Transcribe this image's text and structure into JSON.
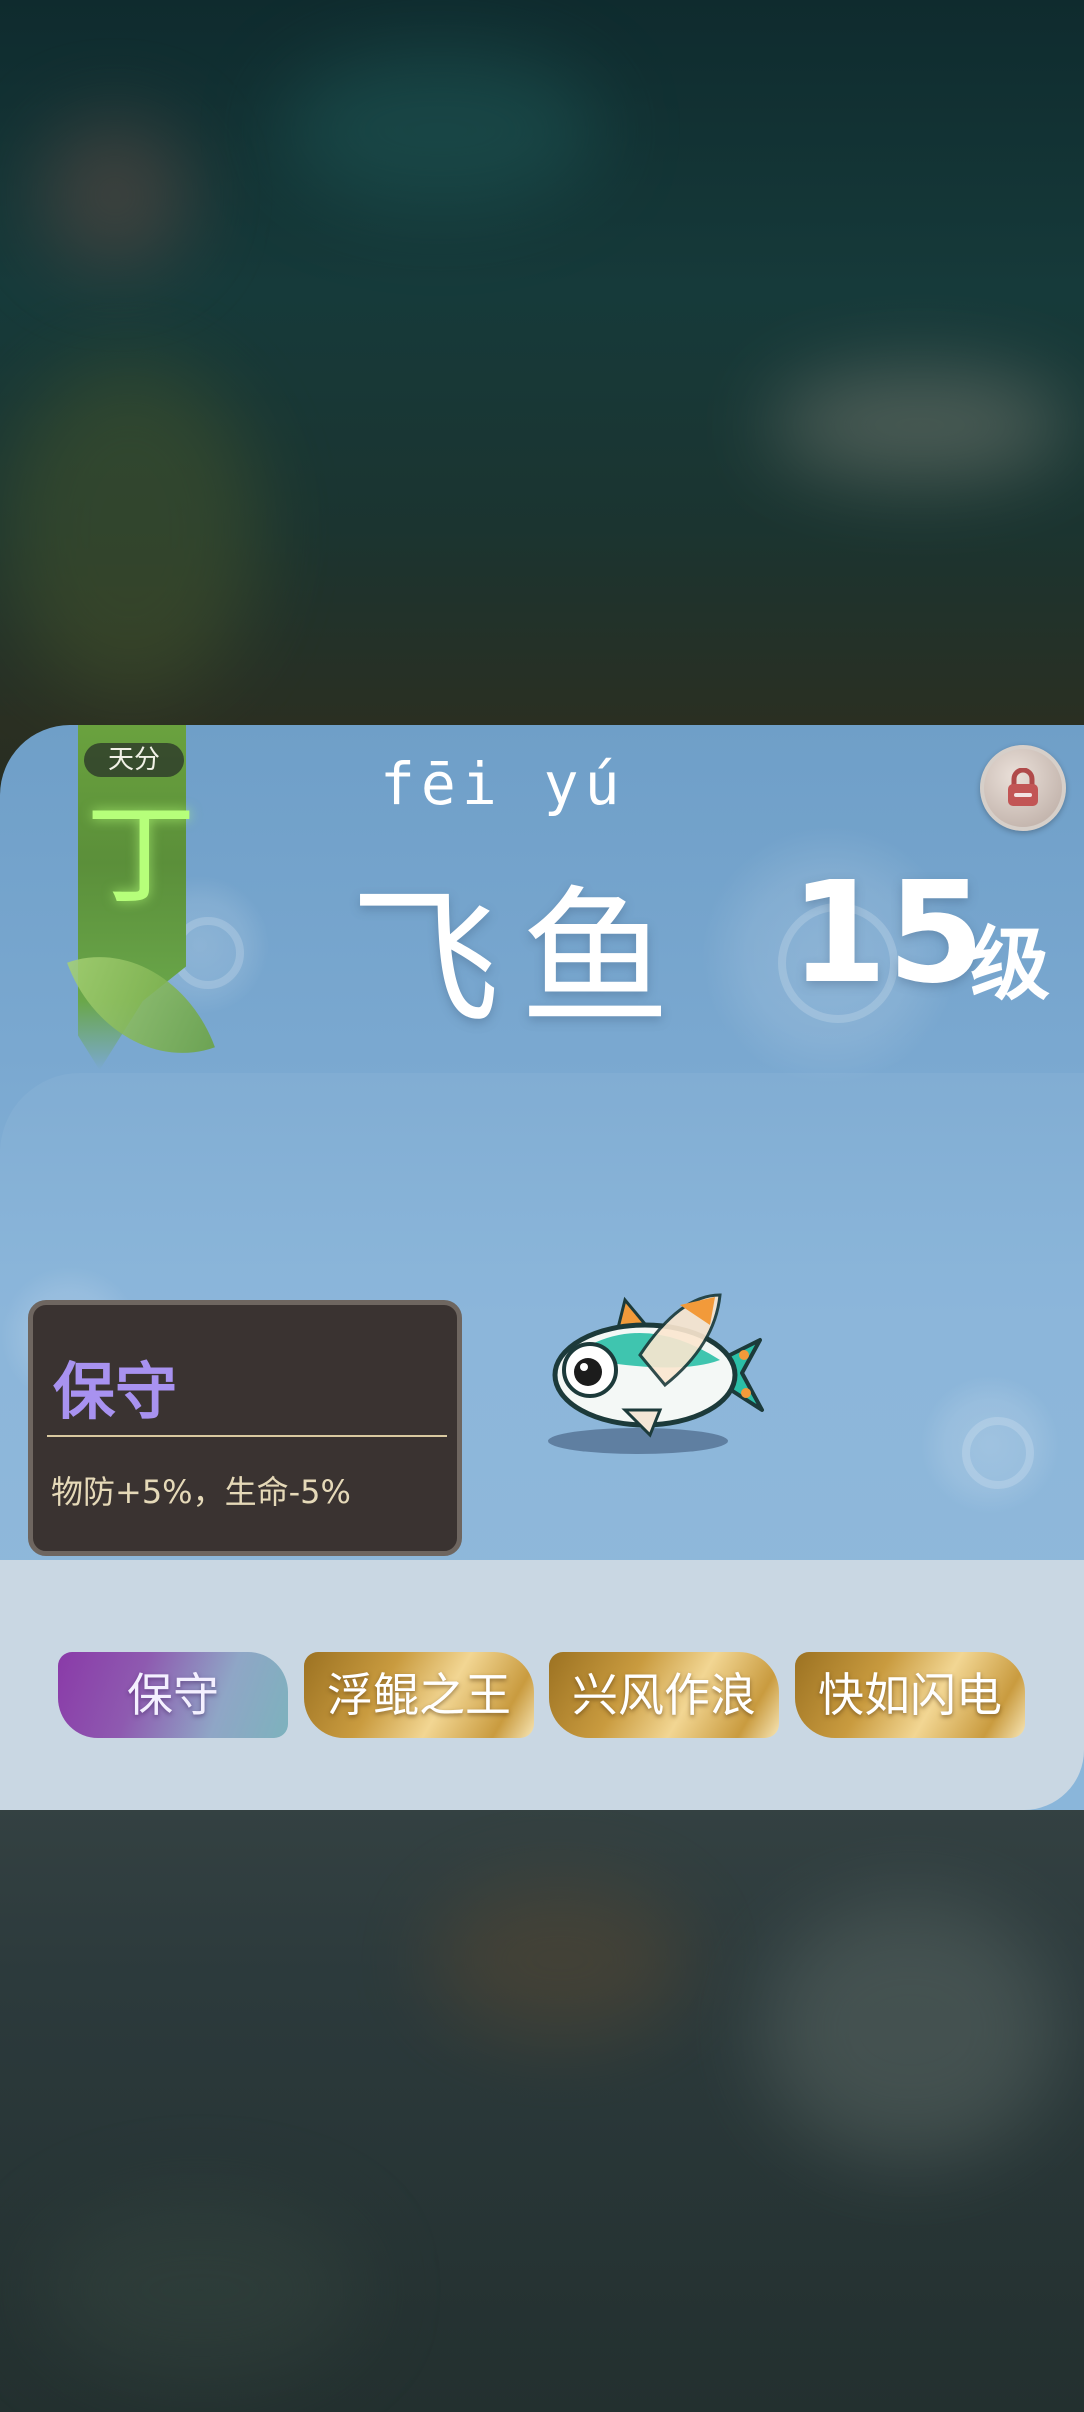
{
  "header": {
    "talent_label": "天分",
    "talent_grade": "丁",
    "pinyin": "fēi yú",
    "name": "飞鱼",
    "level": "15",
    "level_unit": "级"
  },
  "trait": {
    "title": "保守",
    "description": "物防+5%，生命-5%"
  },
  "tabs": [
    {
      "label": "保守",
      "active": true
    },
    {
      "label": "浮鲲之王",
      "active": false
    },
    {
      "label": "兴风作浪",
      "active": false
    },
    {
      "label": "快如闪电",
      "active": false
    }
  ],
  "colors": {
    "card_blue": "#7aa8d0",
    "grade_green": "#b6ff7a",
    "trait_title_purple": "#a892f0",
    "tab_gold": "#c99b3f",
    "tab_active_purple": "#8a3aa8"
  },
  "icons": {
    "lock": "lock-icon"
  }
}
